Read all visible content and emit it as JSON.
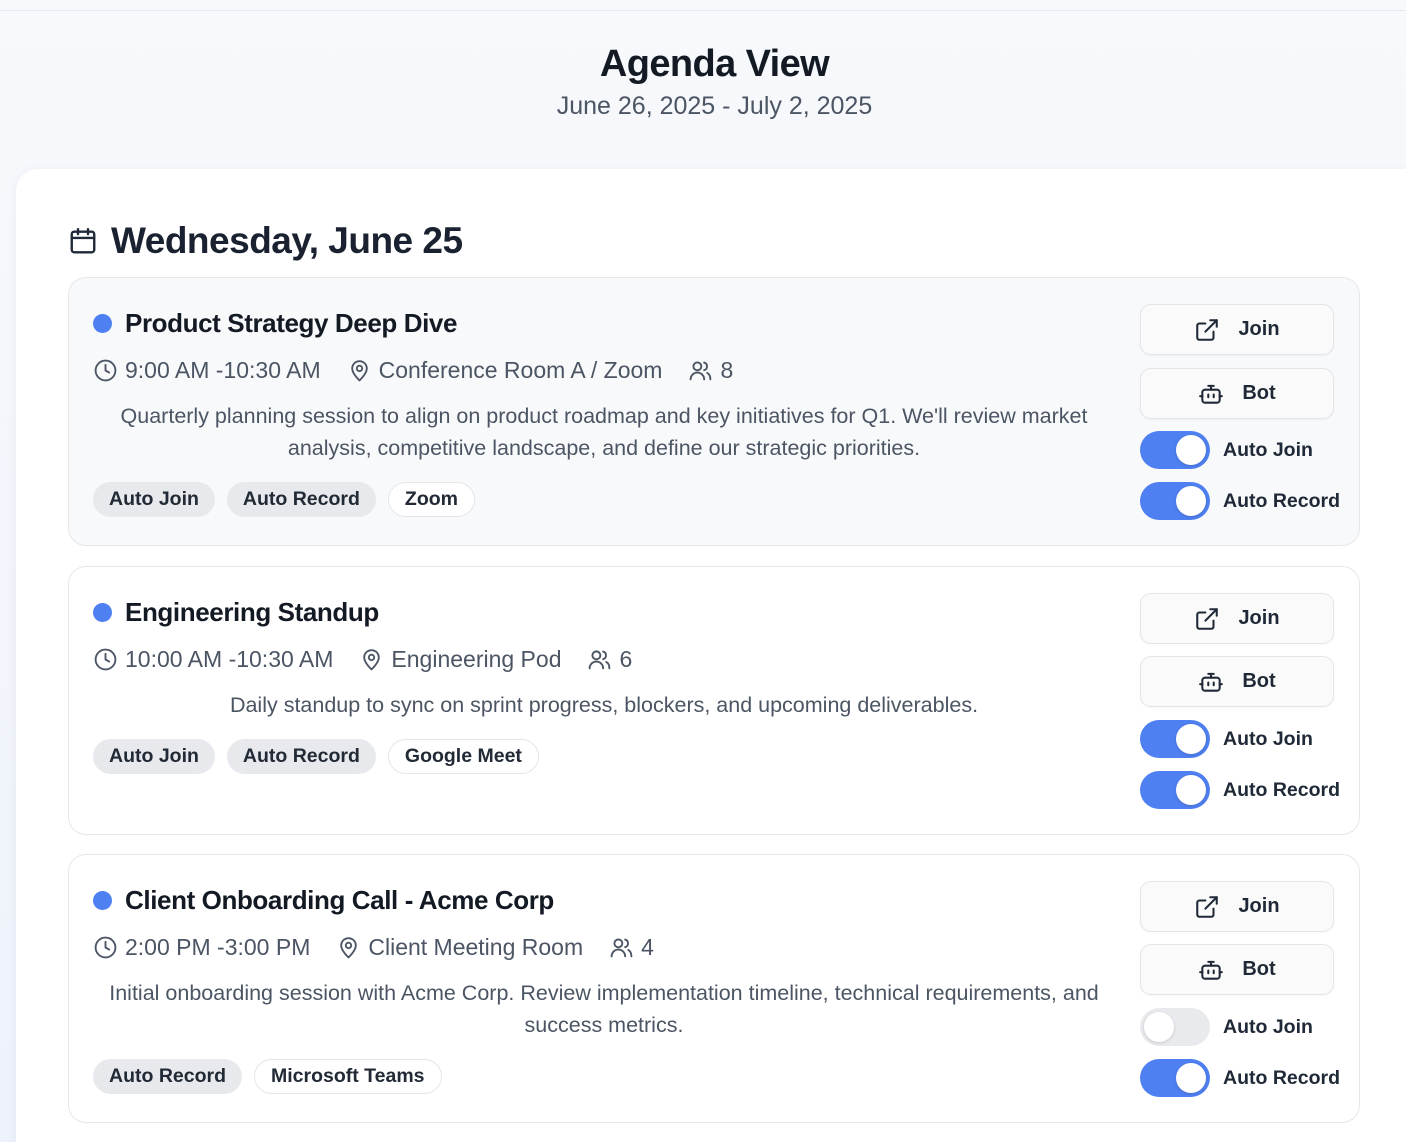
{
  "header": {
    "title": "Agenda View",
    "date_range": "June 26, 2025 - July 2, 2025"
  },
  "day": {
    "title": "Wednesday, June 25"
  },
  "colors": {
    "accent": "#4f80f1",
    "toggle_off": "#e9eaed"
  },
  "events": [
    {
      "title": "Product Strategy Deep Dive",
      "time": "9:00 AM -10:30 AM",
      "location": "Conference Room A / Zoom",
      "attendees": "8",
      "description": "Quarterly planning session to align on product roadmap and key initiatives for Q1. We'll review market analysis, competitive landscape, and define our strategic priorities.",
      "tags": [
        "Auto Join",
        "Auto Record",
        "Zoom"
      ],
      "join_label": "Join",
      "bot_label": "Bot",
      "auto_join_label": "Auto Join",
      "auto_join": true,
      "auto_record_label": "Auto Record",
      "auto_record": true
    },
    {
      "title": "Engineering Standup",
      "time": "10:00 AM -10:30 AM",
      "location": "Engineering Pod",
      "attendees": "6",
      "description": "Daily standup to sync on sprint progress, blockers, and upcoming deliverables.",
      "tags": [
        "Auto Join",
        "Auto Record",
        "Google Meet"
      ],
      "join_label": "Join",
      "bot_label": "Bot",
      "auto_join_label": "Auto Join",
      "auto_join": true,
      "auto_record_label": "Auto Record",
      "auto_record": true
    },
    {
      "title": "Client Onboarding Call - Acme Corp",
      "time": "2:00 PM -3:00 PM",
      "location": "Client Meeting Room",
      "attendees": "4",
      "description": "Initial onboarding session with Acme Corp. Review implementation timeline, technical requirements, and success metrics.",
      "tags": [
        "Auto Record",
        "Microsoft Teams"
      ],
      "join_label": "Join",
      "bot_label": "Bot",
      "auto_join_label": "Auto Join",
      "auto_join": false,
      "auto_record_label": "Auto Record",
      "auto_record": true
    }
  ]
}
